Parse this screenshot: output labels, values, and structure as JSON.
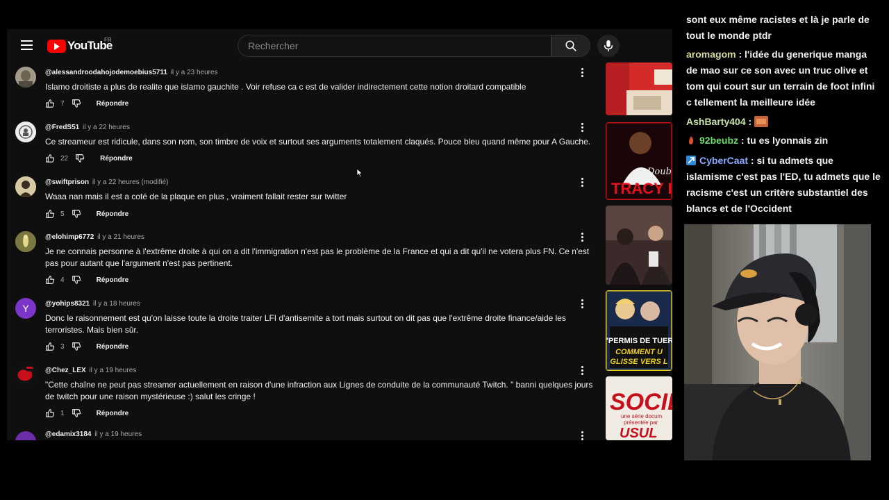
{
  "youtube": {
    "logo_text": "YouTube",
    "region": "FR",
    "search_placeholder": "Rechercher",
    "comments": [
      {
        "author": "@alessandroodahojodemoebius5711",
        "time": "il y a 23 heures",
        "text": "Islamo droitiste a plus de realite que islamo gauchite . Voir refuse ca c est de valider indirectement cette notion droitard compatible",
        "likes": "7",
        "reply": "Répondre"
      },
      {
        "author": "@FredS51",
        "time": "il y a 22 heures",
        "text": "Ce streameur est ridicule, dans son nom, son timbre de voix et surtout ses arguments totalement claqués. Pouce bleu quand même pour A Gauche.",
        "likes": "22",
        "reply": "Répondre"
      },
      {
        "author": "@swiftprison",
        "time": "il y a 22 heures (modifié)",
        "text": "Waaa nan mais il est a coté de la plaque en plus , vraiment fallait rester sur twitter",
        "likes": "5",
        "reply": "Répondre"
      },
      {
        "author": "@elohimp6772",
        "time": "il y a 21 heures",
        "text": "Je ne connais personne à l'extrême droite à qui on a dit l'immigration n'est pas le problème de la France et qui a dit qu'il ne votera plus FN. Ce n'est pas pour autant que l'argument n'est pas pertinent.",
        "likes": "4",
        "reply": "Répondre"
      },
      {
        "author": "@yohips8321",
        "time": "il y a 18 heures",
        "avatar_letter": "Y",
        "text": "Donc le raisonnement est qu'on laisse toute la droite traiter LFI d'antisemite a tort mais surtout on dit pas que l'extrême droite finance/aide les terroristes. Mais bien sûr.",
        "likes": "3",
        "reply": "Répondre"
      },
      {
        "author": "@Chez_LEX",
        "time": "il y a 19 heures",
        "text": "\"Cette chaîne ne peut pas streamer actuellement en raison d'une infraction aux Lignes de conduite de la communauté Twitch. \" banni quelques jours de twitch pour une raison mystérieuse :) salut les cringe !",
        "likes": "1",
        "reply": "Répondre"
      },
      {
        "author": "@edamix3184",
        "time": "il y a 19 heures"
      }
    ],
    "thumbnails": [
      {
        "text_1": "",
        "text_2": ""
      },
      {
        "text_1": "Doub",
        "text_2": "TRACY I"
      },
      {
        "text_1": "",
        "text_2": ""
      },
      {
        "text_1": "\"PERMIS DE TUER",
        "text_2": "COMMENT U",
        "text_3": "GLISSE VERS L"
      },
      {
        "text_1": "SOCIE",
        "text_2": "une série docum",
        "text_3": "présentée par",
        "text_4": "USUL"
      }
    ]
  },
  "chat": {
    "messages": [
      {
        "user": "",
        "text": "sont eux même racistes et là je parle de tout le monde ptdr"
      },
      {
        "user": "aromagom",
        "user_color": "#d8d8a0",
        "text": "l'idée du generique manga de mao sur ce son avec un truc olive et tom qui court sur un terrain de foot infini c tellement la meilleure idée"
      },
      {
        "user": "AshBarty404",
        "user_color": "#c8e0a8",
        "text": ""
      },
      {
        "user": "92beubz",
        "user_color": "#6ddc6d",
        "text": "tu es lyonnais zin"
      },
      {
        "user": "CyberCaat",
        "user_color": "#8aa9ff",
        "text": "si tu admets que islamisme c'est pas l'ED, tu admets que le racisme c'est un critère substantiel des blancs et de l'Occident"
      }
    ],
    "colors": {
      "aromagom": "#d8d8a0",
      "AshBarty404": "#c8e0a8",
      "92beubz": "#6ddc6d",
      "CyberCaat": "#8aa9ff"
    }
  }
}
